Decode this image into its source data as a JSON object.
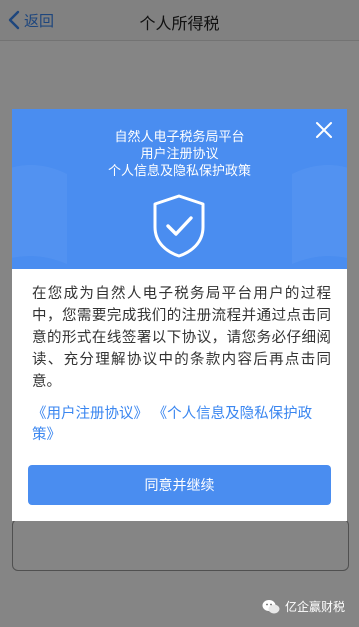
{
  "navbar": {
    "back_label": "返回",
    "title": "个人所得税"
  },
  "dialog": {
    "header": {
      "line1": "自然人电子税务局平台",
      "line2": "用户注册协议",
      "line3": "个人信息及隐私保护政策"
    },
    "description": "在您成为自然人电子税务局平台用户的过程中，您需要完成我们的注册流程并通过点击同意的形式在线签署以下协议，请您务必仔细阅读、充分理解协议中的条款内容后再点击同意。",
    "links": {
      "user_agreement": "《用户注册协议》",
      "privacy_policy": "《个人信息及隐私保护政策》"
    },
    "agree_button": "同意并继续"
  },
  "watermark": {
    "text": "亿企赢财税"
  },
  "colors": {
    "accent": "#4a8df0",
    "link": "#3a86f0",
    "overlay": "rgba(0,0,0,0.48)"
  },
  "icons": [
    "chevron-left-icon",
    "close-icon",
    "shield-check-icon",
    "wechat-icon"
  ]
}
